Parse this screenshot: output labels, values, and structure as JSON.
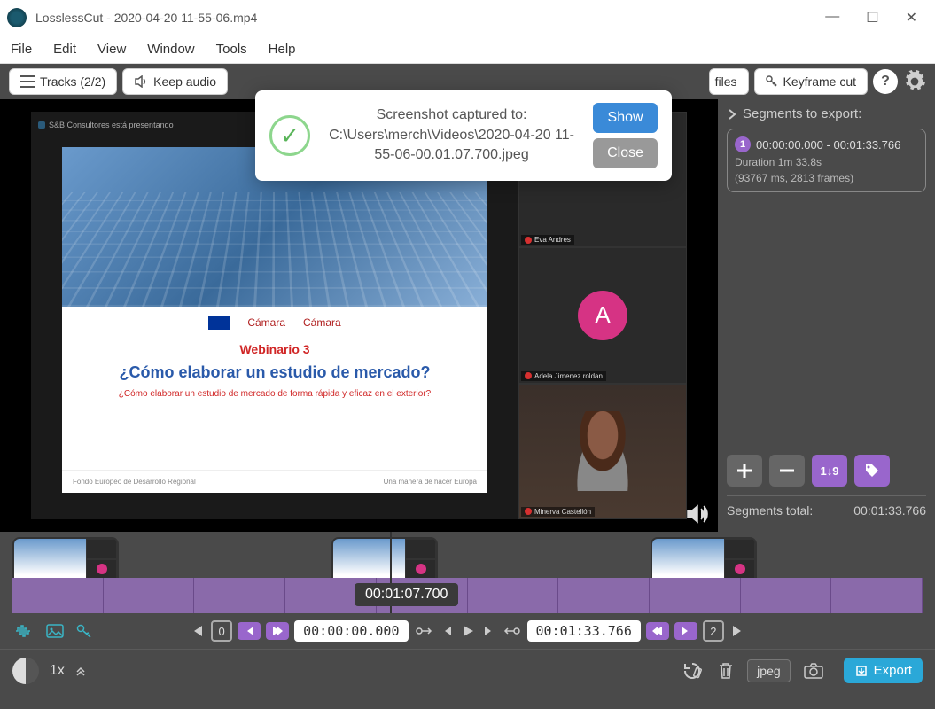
{
  "titlebar": {
    "title": "LosslessCut - 2020-04-20 11-55-06.mp4"
  },
  "menu": {
    "file": "File",
    "edit": "Edit",
    "view": "View",
    "window": "Window",
    "tools": "Tools",
    "help": "Help"
  },
  "toolbar": {
    "tracks": "Tracks (2/2)",
    "keep_audio": "Keep audio",
    "files_suffix": "files",
    "keyframe_cut": "Keyframe cut",
    "help": "?"
  },
  "toast": {
    "line1": "Screenshot captured to:",
    "line2": "C:\\Users\\merch\\Videos\\2020-04-20 11-55-06-00.01.07.700.jpeg",
    "show": "Show",
    "close": "Close"
  },
  "slide": {
    "presenter": "S&B Consultores está presentando",
    "logo1": "Cámara",
    "logo2": "Cámara",
    "webinar": "Webinario 3",
    "question": "¿Cómo elaborar un estudio de mercado?",
    "subtitle": "¿Cómo elaborar un estudio de mercado de forma rápida y eficaz en el exterior?",
    "foot_left": "Fondo Europeo de Desarrollo Regional",
    "foot_right": "Una manera de hacer Europa"
  },
  "participants": {
    "p1": "Eva Andres",
    "p2_initial": "A",
    "p2": "Adela Jimenez roldan",
    "p3": "Minerva Castellón"
  },
  "segments": {
    "header": "Segments to export:",
    "num": "1",
    "range": "00:00:00.000 - 00:01:33.766",
    "duration": "Duration 1m 33.8s",
    "details": "(93767 ms, 2813 frames)",
    "total_label": "Segments total:",
    "total_value": "00:01:33.766",
    "sort_label": "1↓9"
  },
  "timeline": {
    "current_time": "00:01:07.700"
  },
  "controls": {
    "zero": "0",
    "start_time": "00:00:00.000",
    "end_time": "00:01:33.766",
    "two": "2"
  },
  "bottom": {
    "speed": "1x",
    "format": "jpeg",
    "export": "Export"
  }
}
